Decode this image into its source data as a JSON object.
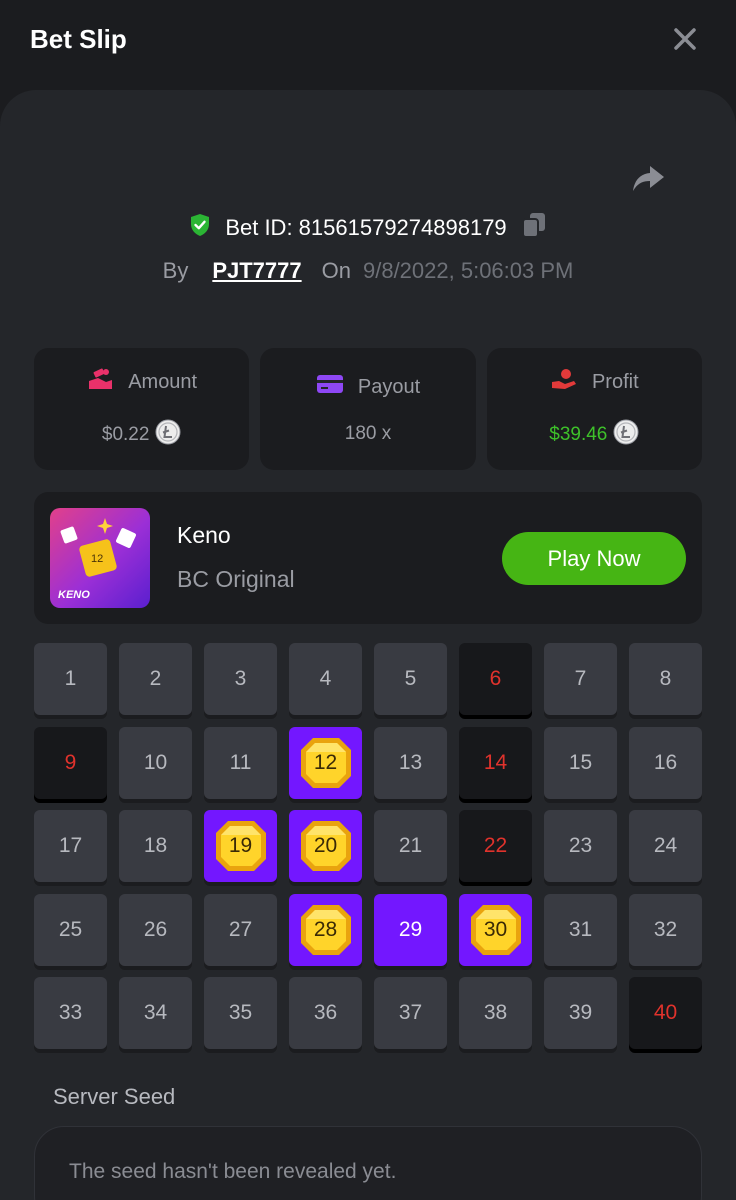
{
  "header": {
    "title": "Bet Slip"
  },
  "bet": {
    "id_label": "Bet ID: 81561579274898179",
    "by_label": "By",
    "user": "PJT7777",
    "on_label": "On",
    "date": "9/8/2022, 5:06:03 PM"
  },
  "stats": {
    "amount": {
      "label": "Amount",
      "value": "$0.22"
    },
    "payout": {
      "label": "Payout",
      "value": "180 x"
    },
    "profit": {
      "label": "Profit",
      "value": "$39.46"
    }
  },
  "game": {
    "name": "Keno",
    "subtitle": "BC Original",
    "thumb_label": "KENO",
    "play_label": "Play Now"
  },
  "keno": {
    "numbers": [
      "1",
      "2",
      "3",
      "4",
      "5",
      "6",
      "7",
      "8",
      "9",
      "10",
      "11",
      "12",
      "13",
      "14",
      "15",
      "16",
      "17",
      "18",
      "19",
      "20",
      "21",
      "22",
      "23",
      "24",
      "25",
      "26",
      "27",
      "28",
      "29",
      "30",
      "31",
      "32",
      "33",
      "34",
      "35",
      "36",
      "37",
      "38",
      "39",
      "40"
    ],
    "states": [
      "",
      "",
      "",
      "",
      "",
      "miss",
      "",
      "",
      "miss",
      "",
      "",
      "hit",
      "",
      "miss",
      "",
      "",
      "",
      "",
      "hit",
      "hit",
      "",
      "miss",
      "",
      "",
      "",
      "",
      "",
      "hit",
      "pick",
      "hit",
      "",
      "",
      "",
      "",
      "",
      "",
      "",
      "",
      "",
      "miss"
    ]
  },
  "seed": {
    "label": "Server Seed",
    "text": "The seed hasn't been revealed yet."
  },
  "colors": {
    "accent_purple": "#7317ff",
    "play_green": "#46b514",
    "profit_green": "#3ec12a",
    "miss_red": "#e0322c"
  }
}
